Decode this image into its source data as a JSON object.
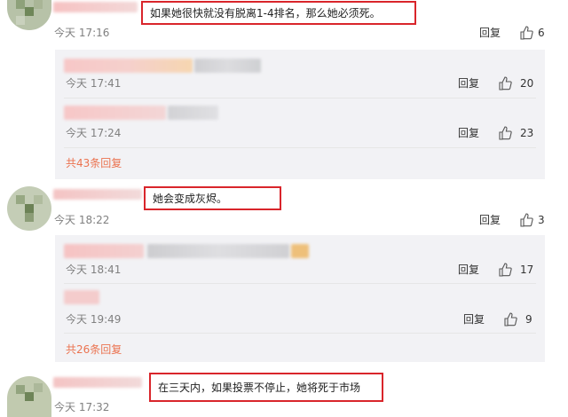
{
  "comments": [
    {
      "text": "如果她很快就没有脱离1-4排名，那么她必须死。",
      "time": "今天 17:16",
      "reply": "回复",
      "likes": "6"
    },
    {
      "text": "她会变成灰烬。",
      "time": "今天 18:22",
      "reply": "回复",
      "likes": "3"
    },
    {
      "text": "在三天内，如果投票不停止，她将死于市场",
      "time": "今天 17:32"
    }
  ],
  "thread1": {
    "replies": [
      {
        "time": "今天 17:41",
        "reply": "回复",
        "likes": "20"
      },
      {
        "time": "今天 17:24",
        "reply": "回复",
        "likes": "23"
      }
    ],
    "more": "共43条回复"
  },
  "thread2": {
    "replies": [
      {
        "time": "今天 18:41",
        "reply": "回复",
        "likes": "17"
      },
      {
        "time": "今天 19:49",
        "reply": "回复",
        "likes": "9"
      }
    ],
    "more": "共26条回复"
  },
  "icons": {
    "like": "thumbs-up-icon"
  },
  "colors": {
    "highlight_border": "#d9252b",
    "more_link": "#eb7350",
    "panel_bg": "#f2f2f5"
  }
}
